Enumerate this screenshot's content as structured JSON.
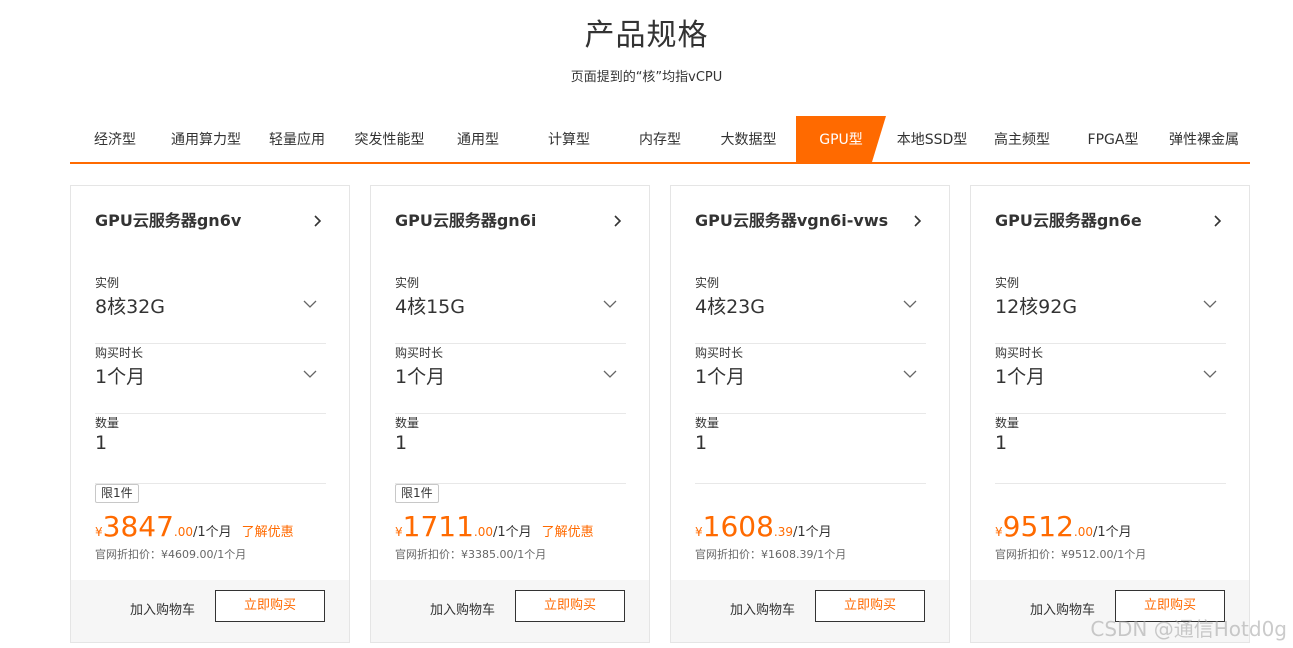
{
  "header": {
    "title": "产品规格",
    "subtitle": "页面提到的“核”均指vCPU"
  },
  "tabs": [
    {
      "label": "经济型"
    },
    {
      "label": "通用算力型"
    },
    {
      "label": "轻量应用"
    },
    {
      "label": "突发性能型"
    },
    {
      "label": "通用型"
    },
    {
      "label": "计算型"
    },
    {
      "label": "内存型"
    },
    {
      "label": "大数据型"
    },
    {
      "label": "GPU型",
      "active": true
    },
    {
      "label": "本地SSD型"
    },
    {
      "label": "高主频型"
    },
    {
      "label": "FPGA型"
    },
    {
      "label": "弹性裸金属"
    }
  ],
  "labels": {
    "instance": "实例",
    "duration": "购买时长",
    "quantity": "数量",
    "add_to_cart": "加入购物车",
    "buy_now": "立即购买",
    "currency": "¥"
  },
  "cards": [
    {
      "name": "GPU云服务器gn6v",
      "instance": "8核32G",
      "duration": "1个月",
      "quantity": "1",
      "badge": "限1件",
      "price_int": "3847",
      "price_dec": ".00",
      "price_unit": "/1个月",
      "promo": "了解优惠",
      "official": "官网折扣价：¥4609.00/1个月"
    },
    {
      "name": "GPU云服务器gn6i",
      "instance": "4核15G",
      "duration": "1个月",
      "quantity": "1",
      "badge": "限1件",
      "price_int": "1711",
      "price_dec": ".00",
      "price_unit": "/1个月",
      "promo": "了解优惠",
      "official": "官网折扣价：¥3385.00/1个月"
    },
    {
      "name": "GPU云服务器vgn6i-vws",
      "instance": "4核23G",
      "duration": "1个月",
      "quantity": "1",
      "badge": "",
      "price_int": "1608",
      "price_dec": ".39",
      "price_unit": "/1个月",
      "promo": "",
      "official": "官网折扣价：¥1608.39/1个月"
    },
    {
      "name": "GPU云服务器gn6e",
      "instance": "12核92G",
      "duration": "1个月",
      "quantity": "1",
      "badge": "",
      "price_int": "9512",
      "price_dec": ".00",
      "price_unit": "/1个月",
      "promo": "",
      "official": "官网折扣价：¥9512.00/1个月"
    }
  ],
  "watermark": "CSDN @通信Hotd0g",
  "colors": {
    "accent": "#ff6a00",
    "text": "#333333",
    "footer_bg": "#f6f6f6"
  }
}
